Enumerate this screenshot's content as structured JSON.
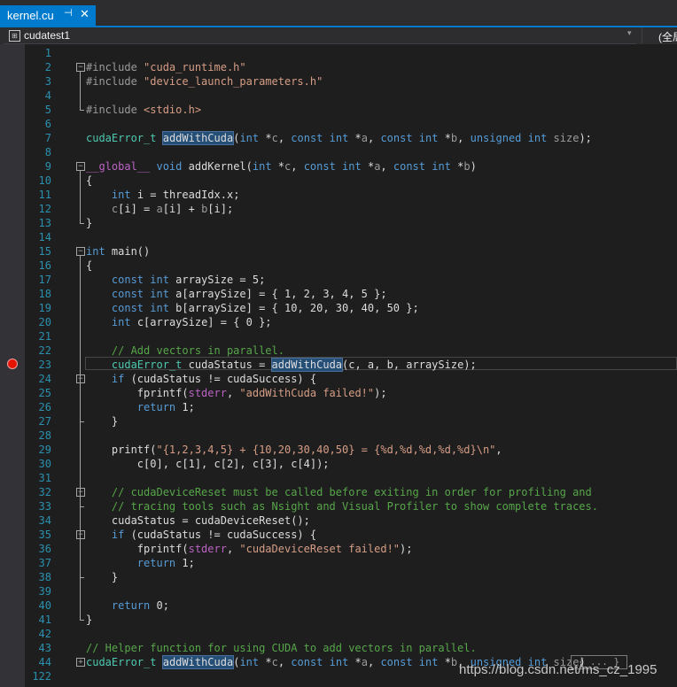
{
  "tab": {
    "title": "kernel.cu",
    "pin_icon": "pin-icon",
    "close_icon": "close-icon",
    "close_glyph": "✕",
    "pin_glyph": "⊣"
  },
  "nav": {
    "scope": "cudatest1",
    "scope_icon": "project-scope-icon",
    "global": "(全局"
  },
  "watermark": "https://blog.csdn.net/ms_cz_1995",
  "editor": {
    "lines": [
      {
        "n": "1",
        "tokens": []
      },
      {
        "n": "2",
        "tokens": [
          {
            "c": "p",
            "v": "#include "
          },
          {
            "c": "s",
            "v": "\"cuda_runtime.h\""
          }
        ]
      },
      {
        "n": "3",
        "tokens": [
          {
            "c": "p",
            "v": "#include "
          },
          {
            "c": "s",
            "v": "\"device_launch_parameters.h\""
          }
        ]
      },
      {
        "n": "4",
        "tokens": []
      },
      {
        "n": "5",
        "tokens": [
          {
            "c": "p",
            "v": "#include "
          },
          {
            "c": "s",
            "v": "<stdio.h>"
          }
        ]
      },
      {
        "n": "6",
        "tokens": []
      },
      {
        "n": "7",
        "tokens": [
          {
            "c": "t",
            "v": "cudaError_t"
          },
          {
            "v": " "
          },
          {
            "c": "hl",
            "v": "addWithCuda"
          },
          {
            "v": "("
          },
          {
            "c": "k",
            "v": "int"
          },
          {
            "v": " *"
          },
          {
            "c": "p",
            "v": "c"
          },
          {
            "v": ", "
          },
          {
            "c": "k",
            "v": "const int"
          },
          {
            "v": " *"
          },
          {
            "c": "p",
            "v": "a"
          },
          {
            "v": ", "
          },
          {
            "c": "k",
            "v": "const int"
          },
          {
            "v": " *"
          },
          {
            "c": "p",
            "v": "b"
          },
          {
            "v": ", "
          },
          {
            "c": "k",
            "v": "unsigned int"
          },
          {
            "v": " "
          },
          {
            "c": "p",
            "v": "size"
          },
          {
            "v": ");"
          }
        ]
      },
      {
        "n": "8",
        "tokens": []
      },
      {
        "n": "9",
        "tokens": [
          {
            "c": "m",
            "v": "__global__"
          },
          {
            "v": " "
          },
          {
            "c": "k",
            "v": "void"
          },
          {
            "v": " addKernel("
          },
          {
            "c": "k",
            "v": "int"
          },
          {
            "v": " *"
          },
          {
            "c": "p",
            "v": "c"
          },
          {
            "v": ", "
          },
          {
            "c": "k",
            "v": "const int"
          },
          {
            "v": " *"
          },
          {
            "c": "p",
            "v": "a"
          },
          {
            "v": ", "
          },
          {
            "c": "k",
            "v": "const int"
          },
          {
            "v": " *"
          },
          {
            "c": "p",
            "v": "b"
          },
          {
            "v": ")"
          }
        ]
      },
      {
        "n": "10",
        "tokens": [
          {
            "v": "{"
          }
        ]
      },
      {
        "n": "11",
        "tokens": [
          {
            "v": "    "
          },
          {
            "c": "k",
            "v": "int"
          },
          {
            "v": " i = threadIdx.x;"
          }
        ]
      },
      {
        "n": "12",
        "tokens": [
          {
            "v": "    "
          },
          {
            "c": "p",
            "v": "c"
          },
          {
            "v": "[i] = "
          },
          {
            "c": "p",
            "v": "a"
          },
          {
            "v": "[i] + "
          },
          {
            "c": "p",
            "v": "b"
          },
          {
            "v": "[i];"
          }
        ]
      },
      {
        "n": "13",
        "tokens": [
          {
            "v": "}"
          }
        ]
      },
      {
        "n": "14",
        "tokens": []
      },
      {
        "n": "15",
        "tokens": [
          {
            "c": "k",
            "v": "int"
          },
          {
            "v": " main()"
          }
        ]
      },
      {
        "n": "16",
        "tokens": [
          {
            "v": "{"
          }
        ]
      },
      {
        "n": "17",
        "tokens": [
          {
            "v": "    "
          },
          {
            "c": "k",
            "v": "const int"
          },
          {
            "v": " arraySize = 5;"
          }
        ]
      },
      {
        "n": "18",
        "tokens": [
          {
            "v": "    "
          },
          {
            "c": "k",
            "v": "const int"
          },
          {
            "v": " a[arraySize] = { 1, 2, 3, 4, 5 };"
          }
        ]
      },
      {
        "n": "19",
        "tokens": [
          {
            "v": "    "
          },
          {
            "c": "k",
            "v": "const int"
          },
          {
            "v": " b[arraySize] = { 10, 20, 30, 40, 50 };"
          }
        ]
      },
      {
        "n": "20",
        "tokens": [
          {
            "v": "    "
          },
          {
            "c": "k",
            "v": "int"
          },
          {
            "v": " c[arraySize] = { 0 };"
          }
        ]
      },
      {
        "n": "21",
        "tokens": []
      },
      {
        "n": "22",
        "tokens": [
          {
            "v": "    "
          },
          {
            "c": "c",
            "v": "// Add vectors in parallel."
          }
        ]
      },
      {
        "n": "23",
        "tokens": [
          {
            "v": "    "
          },
          {
            "c": "t",
            "v": "cudaError_t"
          },
          {
            "v": " cudaStatus = "
          },
          {
            "c": "hl",
            "v": "addWithCuda"
          },
          {
            "v": "(c, a, b, arraySize);"
          }
        ]
      },
      {
        "n": "24",
        "tokens": [
          {
            "v": "    "
          },
          {
            "c": "k",
            "v": "if"
          },
          {
            "v": " (cudaStatus != cudaSuccess) {"
          }
        ]
      },
      {
        "n": "25",
        "tokens": [
          {
            "v": "        fprintf("
          },
          {
            "c": "m",
            "v": "stderr"
          },
          {
            "v": ", "
          },
          {
            "c": "s",
            "v": "\"addWithCuda failed!\""
          },
          {
            "v": ");"
          }
        ]
      },
      {
        "n": "26",
        "tokens": [
          {
            "v": "        "
          },
          {
            "c": "k",
            "v": "return"
          },
          {
            "v": " 1;"
          }
        ]
      },
      {
        "n": "27",
        "tokens": [
          {
            "v": "    }"
          }
        ]
      },
      {
        "n": "28",
        "tokens": []
      },
      {
        "n": "29",
        "tokens": [
          {
            "v": "    printf("
          },
          {
            "c": "s",
            "v": "\"{1,2,3,4,5} + {10,20,30,40,50} = {%d,%d,%d,%d,%d}\\n\""
          },
          {
            "v": ","
          }
        ]
      },
      {
        "n": "30",
        "tokens": [
          {
            "v": "        c[0], c[1], c[2], c[3], c[4]);"
          }
        ]
      },
      {
        "n": "31",
        "tokens": []
      },
      {
        "n": "32",
        "tokens": [
          {
            "v": "    "
          },
          {
            "c": "c",
            "v": "// cudaDeviceReset must be called before exiting in order for profiling and"
          }
        ]
      },
      {
        "n": "33",
        "tokens": [
          {
            "v": "    "
          },
          {
            "c": "c",
            "v": "// tracing tools such as Nsight and Visual Profiler to show complete traces."
          }
        ]
      },
      {
        "n": "34",
        "tokens": [
          {
            "v": "    cudaStatus = cudaDeviceReset();"
          }
        ]
      },
      {
        "n": "35",
        "tokens": [
          {
            "v": "    "
          },
          {
            "c": "k",
            "v": "if"
          },
          {
            "v": " (cudaStatus != cudaSuccess) {"
          }
        ]
      },
      {
        "n": "36",
        "tokens": [
          {
            "v": "        fprintf("
          },
          {
            "c": "m",
            "v": "stderr"
          },
          {
            "v": ", "
          },
          {
            "c": "s",
            "v": "\"cudaDeviceReset failed!\""
          },
          {
            "v": ");"
          }
        ]
      },
      {
        "n": "37",
        "tokens": [
          {
            "v": "        "
          },
          {
            "c": "k",
            "v": "return"
          },
          {
            "v": " 1;"
          }
        ]
      },
      {
        "n": "38",
        "tokens": [
          {
            "v": "    }"
          }
        ]
      },
      {
        "n": "39",
        "tokens": []
      },
      {
        "n": "40",
        "tokens": [
          {
            "v": "    "
          },
          {
            "c": "k",
            "v": "return"
          },
          {
            "v": " 0;"
          }
        ]
      },
      {
        "n": "41",
        "tokens": [
          {
            "v": "}"
          }
        ]
      },
      {
        "n": "42",
        "tokens": []
      },
      {
        "n": "43",
        "tokens": [
          {
            "c": "c",
            "v": "// Helper function for using CUDA to add vectors in parallel."
          }
        ]
      },
      {
        "n": "44",
        "tokens": [
          {
            "c": "t",
            "v": "cudaError_t"
          },
          {
            "v": " "
          },
          {
            "c": "hl",
            "v": "addWithCuda"
          },
          {
            "v": "("
          },
          {
            "c": "k",
            "v": "int"
          },
          {
            "v": " *"
          },
          {
            "c": "p",
            "v": "c"
          },
          {
            "v": ", "
          },
          {
            "c": "k",
            "v": "const int"
          },
          {
            "v": " *"
          },
          {
            "c": "p",
            "v": "a"
          },
          {
            "v": ", "
          },
          {
            "c": "k",
            "v": "const int"
          },
          {
            "v": " *"
          },
          {
            "c": "p",
            "v": "b"
          },
          {
            "v": ", "
          },
          {
            "c": "k",
            "v": "unsigned int"
          },
          {
            "v": " "
          },
          {
            "c": "p",
            "v": "size"
          },
          {
            "v": ")"
          }
        ],
        "collapsed": "{ ... }"
      },
      {
        "n": "122",
        "tokens": []
      }
    ],
    "breakpoint_line": "23",
    "collapsed_fold": "+",
    "expanded_fold": "−"
  }
}
